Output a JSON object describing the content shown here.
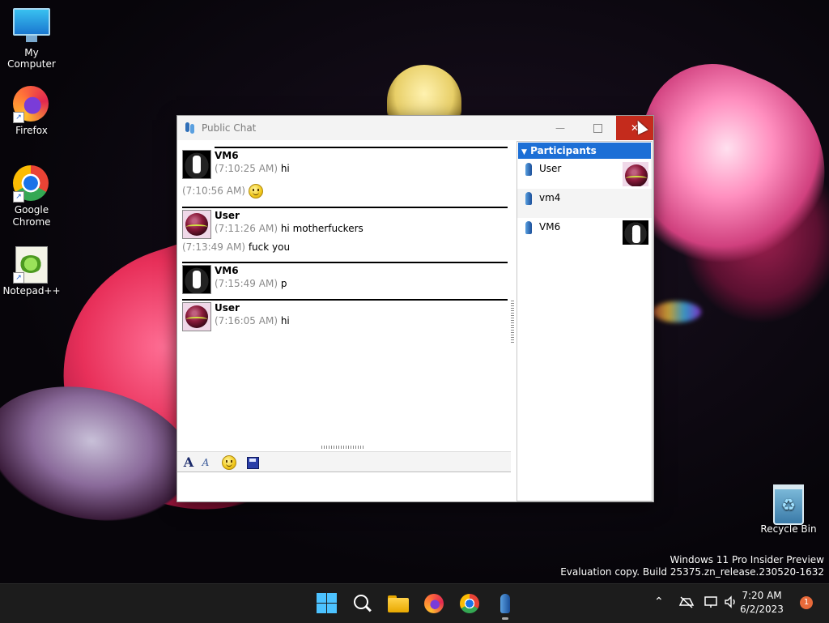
{
  "desktop": {
    "icons": [
      {
        "label": "My Computer"
      },
      {
        "label": "Firefox"
      },
      {
        "label": "Google Chrome"
      },
      {
        "label": "Notepad++"
      },
      {
        "label": "Recycle Bin"
      }
    ],
    "watermark": {
      "line1": "Windows 11 Pro Insider Preview",
      "line2": "Evaluation copy. Build 25375.zn_release.230520-1632"
    }
  },
  "window": {
    "title": "Public Chat",
    "controls": {
      "minimize": "—",
      "maximize": "",
      "close": "✕"
    },
    "messages": [
      {
        "sender": "VM6",
        "avatar": "dog-avatar",
        "lines": [
          {
            "time": "(7:10:25 AM)",
            "text": "hi"
          }
        ],
        "followups": [
          {
            "time": "(7:10:56 AM)",
            "text": "",
            "emoji": "smiley-icon"
          }
        ]
      },
      {
        "sender": "User",
        "avatar": "ball-avatar",
        "lines": [
          {
            "time": "(7:11:26 AM)",
            "text": "hi motherfuckers"
          }
        ],
        "followups": [
          {
            "time": "(7:13:49 AM)",
            "text": "fuck you"
          }
        ]
      },
      {
        "sender": "VM6",
        "avatar": "dog-avatar",
        "lines": [
          {
            "time": "(7:15:49 AM)",
            "text": "p"
          }
        ],
        "followups": []
      },
      {
        "sender": "User",
        "avatar": "ball-avatar",
        "lines": [
          {
            "time": "(7:16:05 AM)",
            "text": "hi"
          }
        ],
        "followups": []
      }
    ],
    "toolbar": {
      "font_glyph": "A",
      "color_glyph": "A",
      "tools": [
        "font-icon",
        "font-color-icon",
        "smiley-icon",
        "save-icon"
      ]
    },
    "input": {
      "value": ""
    },
    "participants": {
      "header": "Participants",
      "items": [
        {
          "name": "User",
          "avatar": "ball-avatar"
        },
        {
          "name": "vm4",
          "avatar": ""
        },
        {
          "name": "VM6",
          "avatar": "dog-avatar"
        }
      ]
    }
  },
  "taskbar": {
    "pinned": [
      "start-icon",
      "search-icon",
      "file-explorer-icon",
      "firefox-icon",
      "chrome-icon",
      "chat-app-icon"
    ],
    "tray": [
      "chevron-up-icon",
      "network-off-icon",
      "display-icon",
      "volume-icon"
    ],
    "time": "7:20 AM",
    "date": "6/2/2023",
    "notification_count": "1"
  },
  "colors": {
    "accent": "#1c6fd6",
    "close_button": "#c42b1c",
    "timestamp": "#8a8a8a"
  }
}
